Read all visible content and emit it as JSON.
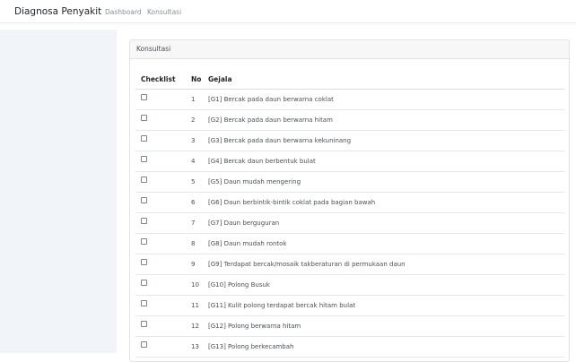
{
  "navbar": {
    "brand": "Diagnosa Penyakit",
    "links": [
      "Dashboard",
      "Konsultasi"
    ]
  },
  "card": {
    "title": "Konsultasi"
  },
  "table": {
    "headers": [
      "Checklist",
      "No",
      "Gejala"
    ],
    "rows": [
      {
        "no": "1",
        "gejala": "[G1] Bercak pada daun berwarna coklat"
      },
      {
        "no": "2",
        "gejala": "[G2] Bercak pada daun berwarna hitam"
      },
      {
        "no": "3",
        "gejala": "[G3] Bercak pada daun berwarna kekuninang"
      },
      {
        "no": "4",
        "gejala": "[G4] Bercak daun berbentuk bulat"
      },
      {
        "no": "5",
        "gejala": "[G5] Daun mudah mengering"
      },
      {
        "no": "6",
        "gejala": "[G6] Daun berbintik-bintik coklat pada bagian bawah"
      },
      {
        "no": "7",
        "gejala": "[G7] Daun berguguran"
      },
      {
        "no": "8",
        "gejala": "[G8] Daun mudah rontok"
      },
      {
        "no": "9",
        "gejala": "[G9] Terdapat bercak/mosaik takberaturan di permukaan daun"
      },
      {
        "no": "10",
        "gejala": "[G10] Polong Busuk"
      },
      {
        "no": "11",
        "gejala": "[G11] Kulit polong terdapat bercak hitam bulat"
      },
      {
        "no": "12",
        "gejala": "[G12] Polong berwarna hitam"
      },
      {
        "no": "13",
        "gejala": "[G13] Polong berkecambah"
      }
    ]
  }
}
